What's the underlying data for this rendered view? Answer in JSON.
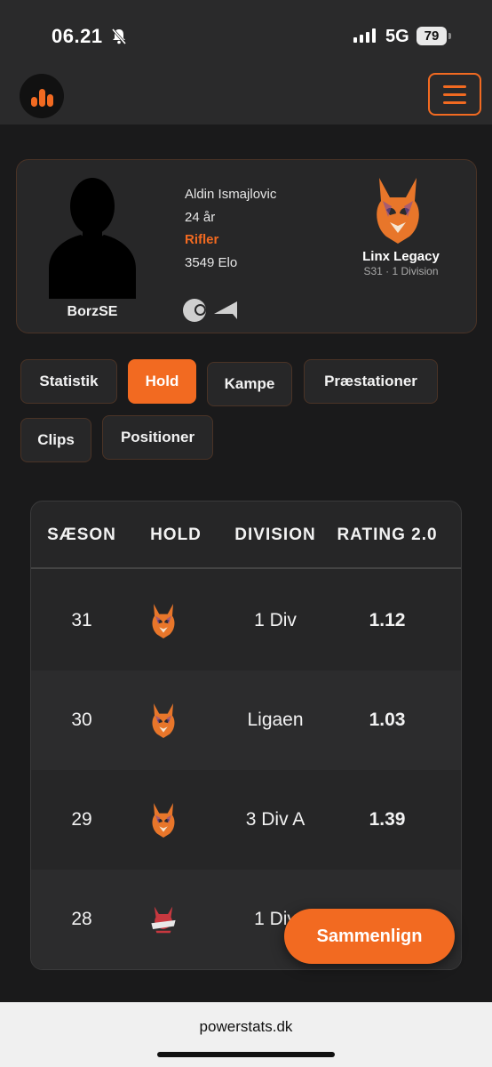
{
  "status_bar": {
    "time": "06.21",
    "network": "5G",
    "battery": "79"
  },
  "nav": {
    "logo_icon": "bar-chart-icon",
    "menu_icon": "hamburger-icon",
    "accent": "#f26a21"
  },
  "profile": {
    "username": "BorzSE",
    "full_name": "Aldin Ismajlovic",
    "age": "24 år",
    "role": "Rifler",
    "elo": "3549 Elo",
    "team_name": "Linx Legacy",
    "team_division": "S31 · 1 Division",
    "social_icons": [
      "steam-icon",
      "faceit-icon"
    ]
  },
  "tabs": [
    {
      "label": "Statistik",
      "active": false
    },
    {
      "label": "Hold",
      "active": true
    },
    {
      "label": "Kampe",
      "active": false
    },
    {
      "label": "Præstationer",
      "active": false
    },
    {
      "label": "Clips",
      "active": false
    },
    {
      "label": "Positioner",
      "active": false
    }
  ],
  "table": {
    "headers": [
      "SÆSON",
      "HOLD",
      "DIVISION",
      "RATING 2.0"
    ],
    "rows": [
      {
        "season": "31",
        "team_logo": "lynx-logo",
        "division": "1 Div",
        "rating": "1.12"
      },
      {
        "season": "30",
        "team_logo": "lynx-logo",
        "division": "Ligaen",
        "rating": "1.03"
      },
      {
        "season": "29",
        "team_logo": "lynx-logo",
        "division": "3 Div A",
        "rating": "1.39"
      },
      {
        "season": "28",
        "team_logo": "sashi-logo",
        "division": "1 Div",
        "rating": ""
      }
    ]
  },
  "compare_button": "Sammenlign",
  "browser": {
    "url": "powerstats.dk"
  }
}
